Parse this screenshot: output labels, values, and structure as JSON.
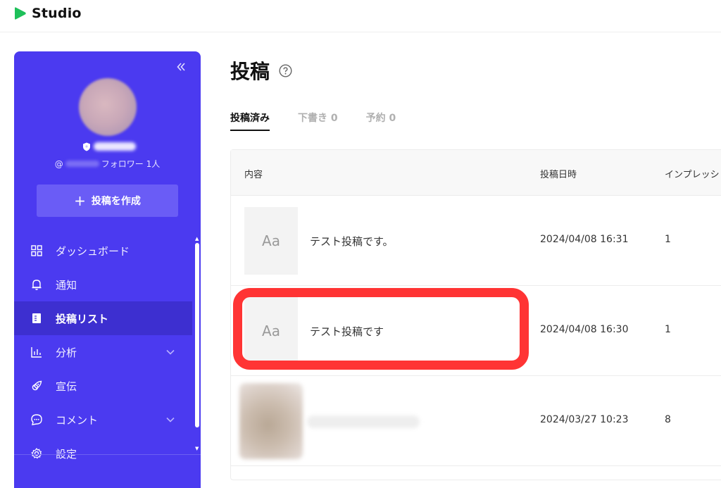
{
  "header": {
    "app_name": "Studio",
    "brand_color": "#1ec05a"
  },
  "sidebar": {
    "bg_color": "#4b3af0",
    "handle_prefix": "@",
    "followers_text": "フォロワー 1人",
    "create_button": {
      "icon": "plus-icon",
      "label": "投稿を作成"
    },
    "items": [
      {
        "label": "ダッシュボード",
        "icon": "grid-icon"
      },
      {
        "label": "通知",
        "icon": "bell-icon"
      },
      {
        "label": "投稿リスト",
        "icon": "document-icon",
        "active": true
      },
      {
        "label": "分析",
        "icon": "bar-chart-icon",
        "expandable": true
      },
      {
        "label": "宣伝",
        "icon": "rocket-icon"
      },
      {
        "label": "コメント",
        "icon": "comment-icon",
        "expandable": true
      },
      {
        "label": "設定",
        "icon": "gear-icon"
      }
    ]
  },
  "main": {
    "title": "投稿",
    "tabs": [
      {
        "label": "投稿済み",
        "active": true
      },
      {
        "label": "下書き 0"
      },
      {
        "label": "予約 0"
      }
    ],
    "table": {
      "columns": [
        "内容",
        "投稿日時",
        "インプレッシ"
      ],
      "rows": [
        {
          "thumb": "Aa",
          "text": "テスト投稿です。",
          "date": "2024/04/08 16:31",
          "impressions": "1"
        },
        {
          "thumb": "Aa",
          "text": "テスト投稿です",
          "date": "2024/04/08 16:30",
          "impressions": "1"
        },
        {
          "thumb": "",
          "text": "",
          "date": "2024/03/27 10:23",
          "impressions": "8"
        }
      ]
    }
  },
  "annotation": {
    "color": "#ff3434"
  }
}
